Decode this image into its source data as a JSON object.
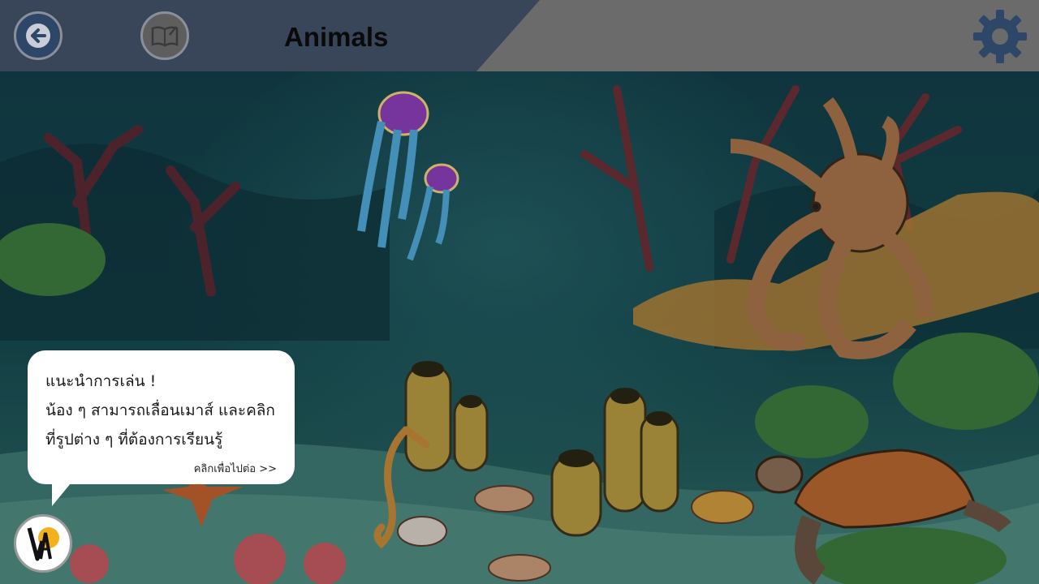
{
  "header": {
    "title": "Animals",
    "navy_color": "#394559",
    "gray_color": "#6b6b6b"
  },
  "buttons": {
    "back": {
      "icon": "arrow-left-icon"
    },
    "book": {
      "icon": "book-pencil-icon"
    },
    "settings": {
      "icon": "gear-icon",
      "color": "#2e4668"
    }
  },
  "tip": {
    "heading": "แนะนำการเล่น !",
    "line1": "น้อง ๆ สามารถเลื่อนเมาส์ และคลิก",
    "line2": "ที่รูปต่าง ๆ ที่ต้องการเรียนรู้",
    "continue_label": "คลิกเพื่อไปต่อ >>"
  },
  "logo": {
    "alt": "VAP"
  },
  "scene": {
    "animals": [
      "jellyfish",
      "jellyfish-small",
      "octopus",
      "sea-turtle",
      "seahorse",
      "starfish"
    ]
  }
}
